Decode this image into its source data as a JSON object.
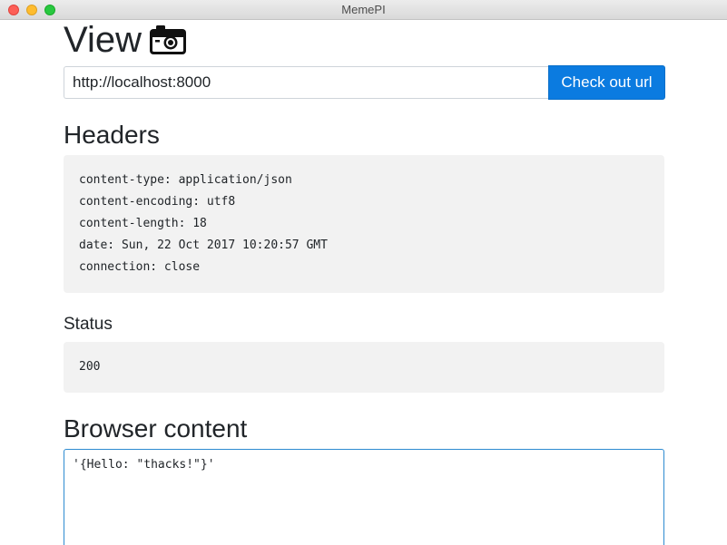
{
  "window": {
    "title": "MemePI"
  },
  "page": {
    "title": "View",
    "title_icon": "camera-icon"
  },
  "url_bar": {
    "value": "http://localhost:8000",
    "button_label": "Check out url",
    "button_color": "#0b7be0"
  },
  "headers_section": {
    "heading": "Headers",
    "lines": [
      "content-type: application/json",
      "content-encoding: utf8",
      "content-length: 18",
      "date: Sun, 22 Oct 2017 10:20:57 GMT",
      "connection: close"
    ]
  },
  "status_section": {
    "heading": "Status",
    "value": "200"
  },
  "browser_content": {
    "heading": "Browser content",
    "value": "'{Hello: \"thacks!\"}'"
  }
}
